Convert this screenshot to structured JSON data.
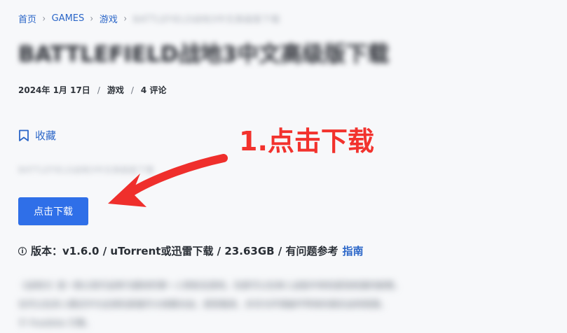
{
  "breadcrumb": {
    "home": "首页",
    "games": "GAMES",
    "category": "游戏",
    "current": "BATTLEFIELD战地3中文高级版下载"
  },
  "title": "BATTLEFIELD战地3中文高级版下载",
  "meta": {
    "date": "2024年 1月 17日",
    "category": "游戏",
    "comments": "4 评论"
  },
  "favorite": {
    "label": "收藏",
    "icon": "bookmark-icon"
  },
  "description_hidden": "BATTLEFIELD战地3中文高级版下载",
  "download_button": "点击下载",
  "annotation": {
    "text": "1.点击下载",
    "color": "#f2322d"
  },
  "version": {
    "icon": "info-icon",
    "prefix": "版本：v1.6.0 / uTorrent或迅雷下载 / 23.63GB / 有问题参考",
    "link_text": "指南"
  },
  "blurred_text": [
    "《战地3》是一款以现代战争为题材的第一人称射击游戏，玩家可以在单人战役中体验紧张刺激的剧情，",
    "也可以在多人模式中与全球玩家展开大规模对战，感受载具、步兵与环境破坏带来的真实战场氛围，",
    "于 Frostbite 引擎。"
  ]
}
